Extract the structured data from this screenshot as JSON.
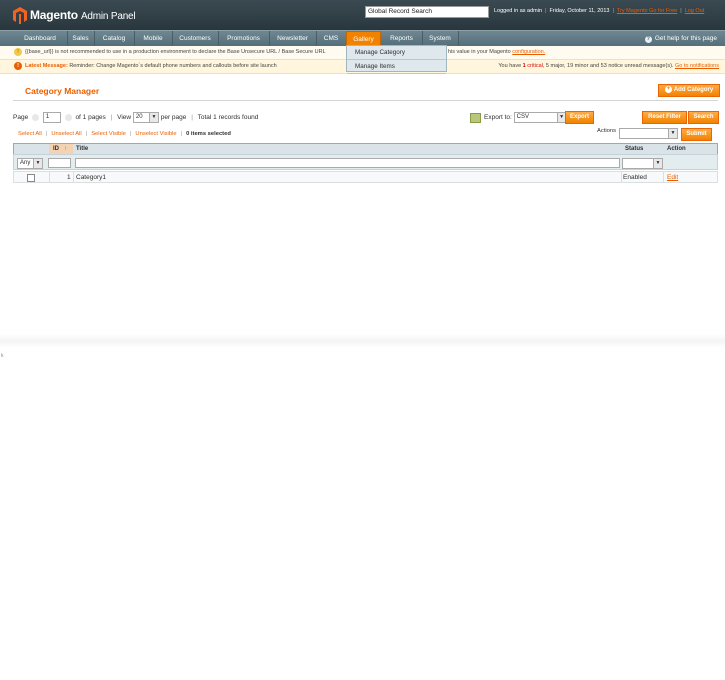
{
  "header": {
    "logo_brand": "Magento",
    "logo_sub": "Admin Panel",
    "search_value": "Global Record Search",
    "logged_in": "Logged in as admin",
    "date": "Friday, October 11, 2013",
    "go_free": "Try Magento Go for Free",
    "logout": "Log Out"
  },
  "nav": {
    "items": [
      "Dashboard",
      "Sales",
      "Catalog",
      "Mobile",
      "Customers",
      "Promotions",
      "Newsletter",
      "CMS",
      "Gallery",
      "Reports",
      "System"
    ],
    "active": "Gallery",
    "help": "Get help for this page"
  },
  "dropdown": {
    "items": [
      "Manage Category",
      "Manage Items"
    ]
  },
  "messages": {
    "security_text": "{{base_url}} is not recommended to use in a production environment to declare the Base Unsecure URL / Base Secure URL",
    "security_tail": "his value in your Magento",
    "security_link": "configuration.",
    "latest_label": "Latest Message:",
    "latest_text": "Reminder: Change Magento`s default phone numbers and callouts before site launch",
    "notice_prefix": "You have",
    "critical_count": "1",
    "critical_label": "critical,",
    "major": "5 major,",
    "minor": "19 minor and",
    "notice": "53 notice unread message(s).",
    "notice_link": "Go to notifications"
  },
  "page": {
    "title": "Category Manager",
    "add_button": "Add Category"
  },
  "pager": {
    "page_label": "Page",
    "page_value": "1",
    "of_pages": "of 1 pages",
    "view_label": "View",
    "view_value": "20",
    "per_page": "per page",
    "total": "Total 1 records found"
  },
  "export": {
    "label": "Export to:",
    "value": "CSV",
    "button": "Export"
  },
  "buttons": {
    "reset_filter": "Reset Filter",
    "search": "Search",
    "submit": "Submit"
  },
  "massaction": {
    "select_all": "Select All",
    "unselect_all": "Unselect All",
    "select_visible": "Select Visible",
    "unselect_visible": "Unselect Visible",
    "selected_count": "0",
    "selected_label": "items selected",
    "actions_label": "Actions"
  },
  "grid": {
    "columns": [
      "ID",
      "Title",
      "Status",
      "Action"
    ],
    "filter_any": "Any",
    "rows": [
      {
        "id": "1",
        "title": "Category1",
        "status": "Enabled",
        "action": "Edit"
      }
    ]
  },
  "edge_label": "k"
}
